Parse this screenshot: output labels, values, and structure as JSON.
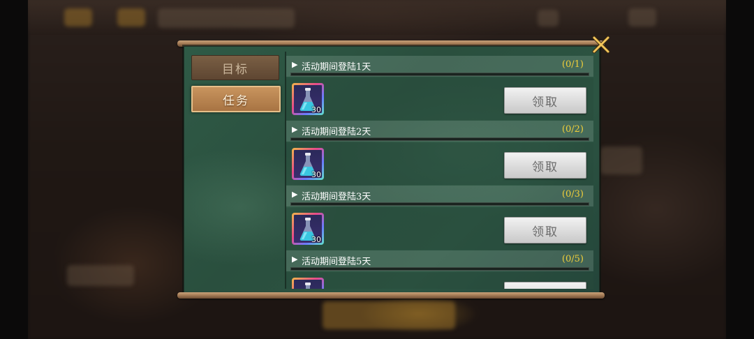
{
  "tabs": [
    {
      "label": "目标",
      "active": false
    },
    {
      "label": "任务",
      "active": true
    }
  ],
  "tasks": [
    {
      "title": "活动期间登陆1天",
      "progress_text": "(0/1)",
      "progress": 0,
      "reward_icon": "blue-potion-flask-icon",
      "reward_qty": "30",
      "claim_label": "领取"
    },
    {
      "title": "活动期间登陆2天",
      "progress_text": "(0/2)",
      "progress": 0,
      "reward_icon": "blue-potion-flask-icon",
      "reward_qty": "30",
      "claim_label": "领取"
    },
    {
      "title": "活动期间登陆3天",
      "progress_text": "(0/3)",
      "progress": 0,
      "reward_icon": "blue-potion-flask-icon",
      "reward_qty": "30",
      "claim_label": "领取"
    },
    {
      "title": "活动期间登陆5天",
      "progress_text": "(0/5)",
      "progress": 0,
      "reward_icon": "blue-potion-flask-icon",
      "reward_qty": "",
      "claim_label": ""
    }
  ],
  "close_icon": "close-x-icon",
  "colors": {
    "progress_text": "#f1cf3a",
    "active_tab": "#c8945e",
    "panel": "#2c5442"
  }
}
